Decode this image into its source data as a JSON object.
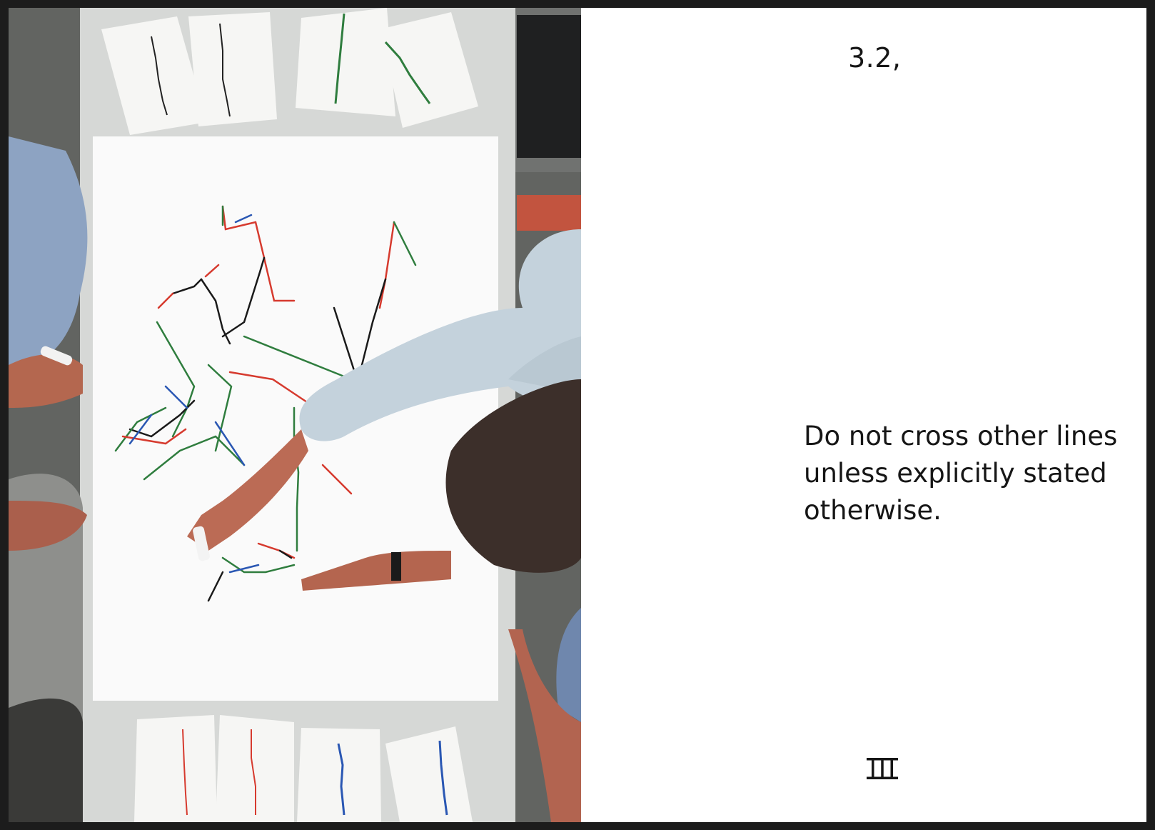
{
  "page": {
    "section_number": "3.2,",
    "statement": "Do not cross other lines unless explicitly stated otherwise.",
    "logo_icon": "triple-bar-logo-icon"
  },
  "photo": {
    "description_icon": "workshop-photo",
    "line_colors": [
      "#1a1a1a",
      "#2f7d3e",
      "#d63a2e",
      "#2a57b3"
    ]
  }
}
